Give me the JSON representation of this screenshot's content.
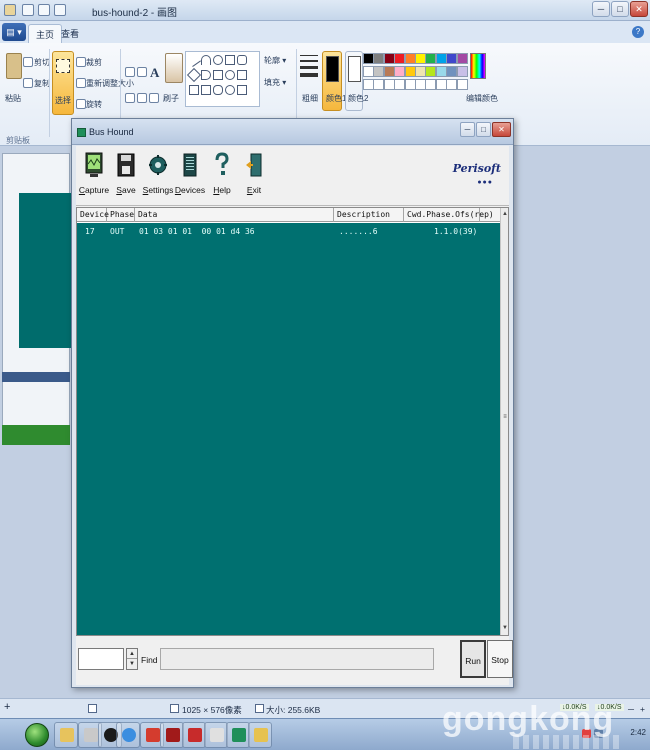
{
  "paint": {
    "title": "bus-hound-2 - 画图",
    "window_buttons": {
      "minimize": "─",
      "maximize": "□",
      "close": "✕"
    },
    "file_menu_label": "▤ ▾",
    "tabs": [
      {
        "label": "主页",
        "active": true
      },
      {
        "label": "查看",
        "active": false
      }
    ],
    "help_label": "?",
    "ribbon": {
      "clipboard": {
        "paste": "粘贴",
        "cut": "剪切",
        "copy": "复制",
        "group": "剪贴板"
      },
      "image": {
        "select": "选择",
        "crop": "裁剪",
        "resize": "重新调整大小",
        "rotate": "旋转"
      },
      "tools_text": "A",
      "brushes": "刷子",
      "shapes": {
        "outline": "轮廓 ▾",
        "fill": "填充 ▾"
      },
      "size": "粗细",
      "color1": "颜色1",
      "color2": "颜色2",
      "edit_colors": "编辑颜色",
      "palette": [
        "#000000",
        "#7f7f7f",
        "#880015",
        "#ed1c24",
        "#ff7f27",
        "#fff200",
        "#22b14c",
        "#00a2e8",
        "#3f48cc",
        "#a349a4",
        "#ffffff",
        "#c3c3c3",
        "#b97a57",
        "#ffaec9",
        "#ffc90e",
        "#efe4b0",
        "#b5e61d",
        "#99d9ea",
        "#7092be",
        "#c8bfe7",
        "#ffffff",
        "#ffffff",
        "#ffffff",
        "#ffffff",
        "#ffffff",
        "#ffffff",
        "#ffffff",
        "#ffffff",
        "#ffffff",
        "#ffffff"
      ]
    },
    "status": {
      "add": "+",
      "dimensions": "1025 × 576像素",
      "size": "大小: 255.6KB",
      "net1": "↓0.0K/S",
      "net2": "↓0.0K/S",
      "zoom_minus": "─",
      "zoom_plus": "+"
    }
  },
  "bushound": {
    "title": "Bus Hound",
    "window_buttons": {
      "minimize": "─",
      "maximize": "□",
      "close": "✕"
    },
    "toolbar": [
      {
        "name": "capture",
        "label": "Capture",
        "icon": "monitor-icon"
      },
      {
        "name": "save",
        "label": "Save",
        "icon": "floppy-disk-icon"
      },
      {
        "name": "settings",
        "label": "Settings",
        "icon": "gear-icon"
      },
      {
        "name": "devices",
        "label": "Devices",
        "icon": "chip-icon"
      },
      {
        "name": "help",
        "label": "Help",
        "icon": "question-mark-icon"
      },
      {
        "name": "exit",
        "label": "Exit",
        "icon": "door-exit-icon"
      }
    ],
    "logo": "Perisoft",
    "logo_dots": "●●●",
    "columns": [
      "Device",
      "Phase",
      "Data",
      "Description",
      "Cwd.Phase.Ofs(rep)"
    ],
    "rows": [
      {
        "device": "17",
        "phase": "OUT",
        "data": "01 03 01 01  00 01 d4 36",
        "description": ".......6",
        "cwd": "1.1.0(39)"
      }
    ],
    "scroll": {
      "up": "▲",
      "grip": "≡",
      "down": "▼"
    },
    "find": {
      "label": "Find",
      "value": ""
    },
    "spin": {
      "up": "▲",
      "down": "▼"
    },
    "buttons": {
      "run": "Run",
      "stop": "Stop"
    }
  },
  "taskbar": {
    "clock": "2:42",
    "watermark": "gongkong"
  }
}
